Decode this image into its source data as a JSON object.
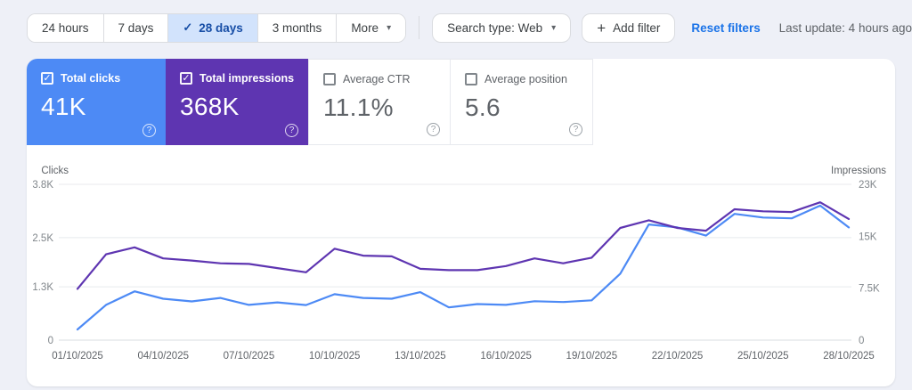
{
  "icons": {
    "check": "✓",
    "caret_down": "▾",
    "plus": "+",
    "help": "?"
  },
  "toolbar": {
    "selected_range_index": 2,
    "date_ranges": [
      {
        "label": "24 hours"
      },
      {
        "label": "7 days"
      },
      {
        "label": "28 days"
      },
      {
        "label": "3 months"
      },
      {
        "label": "More"
      }
    ],
    "search_type_label": "Search type: Web",
    "add_filter_label": "Add filter",
    "reset_filters_label": "Reset filters",
    "last_update": "Last update: 4 hours ago"
  },
  "metric_cards": [
    {
      "label": "Total clicks",
      "value": "41K",
      "checked": true,
      "color": "#4d8af5",
      "text": "#ffffff"
    },
    {
      "label": "Total impressions",
      "value": "368K",
      "checked": true,
      "color": "#5e35b1",
      "text": "#ffffff"
    },
    {
      "label": "Average CTR",
      "value": "11.1%",
      "checked": false,
      "color": "#ffffff",
      "text": "#5f6368"
    },
    {
      "label": "Average position",
      "value": "5.6",
      "checked": false,
      "color": "#ffffff",
      "text": "#5f6368"
    }
  ],
  "chart_data": {
    "type": "line",
    "x": [
      "01/10/2025",
      "02/10/2025",
      "03/10/2025",
      "04/10/2025",
      "05/10/2025",
      "06/10/2025",
      "07/10/2025",
      "08/10/2025",
      "09/10/2025",
      "10/10/2025",
      "11/10/2025",
      "12/10/2025",
      "13/10/2025",
      "14/10/2025",
      "15/10/2025",
      "16/10/2025",
      "17/10/2025",
      "18/10/2025",
      "19/10/2025",
      "20/10/2025",
      "21/10/2025",
      "22/10/2025",
      "23/10/2025",
      "24/10/2025",
      "25/10/2025",
      "26/10/2025",
      "27/10/2025",
      "28/10/2025"
    ],
    "x_tick_indices": [
      0,
      3,
      6,
      9,
      12,
      15,
      18,
      21,
      24,
      27
    ],
    "series": [
      {
        "name": "Clicks",
        "axis": "left",
        "color": "#4d8af5",
        "values": [
          260,
          860,
          1190,
          1010,
          945,
          1030,
          860,
          920,
          855,
          1120,
          1030,
          1010,
          1170,
          800,
          880,
          860,
          950,
          930,
          970,
          1620,
          2820,
          2750,
          2550,
          3080,
          2990,
          2970,
          3280,
          2750
        ]
      },
      {
        "name": "Impressions",
        "axis": "right",
        "color": "#5e35b1",
        "values": [
          7400,
          12400,
          13400,
          11800,
          11500,
          11100,
          11000,
          10400,
          9800,
          13200,
          12200,
          12100,
          10300,
          10100,
          10100,
          10700,
          11800,
          11100,
          11900,
          16200,
          17300,
          16200,
          15800,
          18900,
          18600,
          18500,
          19900,
          17500
        ]
      }
    ],
    "left_axis": {
      "label": "Clicks",
      "max": 3800,
      "ticks": [
        {
          "value": 0,
          "label": "0"
        },
        {
          "value": 1300,
          "label": "1.3K"
        },
        {
          "value": 2500,
          "label": "2.5K"
        },
        {
          "value": 3800,
          "label": "3.8K"
        }
      ]
    },
    "right_axis": {
      "label": "Impressions",
      "max": 22500,
      "ticks": [
        {
          "value": 0,
          "label": "0"
        },
        {
          "value": 7500,
          "label": "7.5K"
        },
        {
          "value": 15000,
          "label": "15K"
        },
        {
          "value": 22500,
          "label": "23K"
        }
      ]
    },
    "grid": true,
    "legend_position": "none",
    "totals": {
      "clicks": "41K",
      "impressions": "368K",
      "avg_ctr": "11.1%",
      "avg_position": "5.6"
    }
  }
}
